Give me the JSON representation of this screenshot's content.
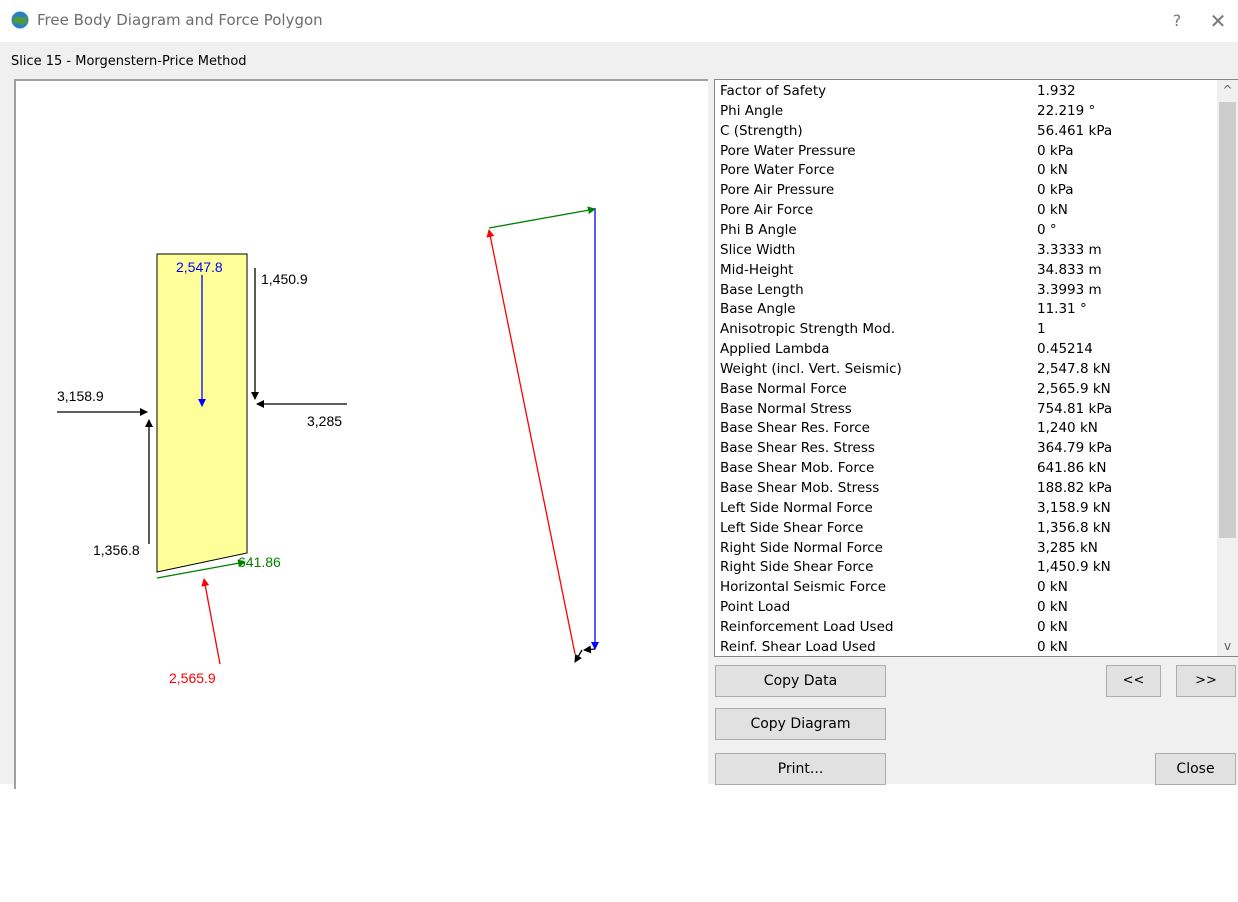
{
  "window": {
    "title": "Free Body Diagram and Force Polygon",
    "help_glyph": "?",
    "close_glyph": "✕",
    "icon": "earth-globe-icon"
  },
  "slice_label": "Slice  15 - Morgenstern-Price  Method",
  "diagram": {
    "weight_label": "2,547.8",
    "right_shear_label": "1,450.9",
    "left_normal_label": "3,158.9",
    "right_normal_label": "3,285",
    "left_shear_label": "1,356.8",
    "base_shear_label": "641.86",
    "base_normal_label": "2,565.9",
    "colors": {
      "slice_fill": "#ffff99",
      "weight": "#0000ff",
      "base_shear": "#008000",
      "base_normal": "#ff0000",
      "side_forces": "#000000"
    }
  },
  "properties": [
    {
      "name": "Factor of Safety",
      "value": "1.932"
    },
    {
      "name": "Phi Angle",
      "value": "22.219 °"
    },
    {
      "name": "C (Strength)",
      "value": "56.461 kPa"
    },
    {
      "name": "Pore Water Pressure",
      "value": "0 kPa"
    },
    {
      "name": "Pore Water Force",
      "value": "0 kN"
    },
    {
      "name": "Pore Air Pressure",
      "value": "0 kPa"
    },
    {
      "name": "Pore Air Force",
      "value": "0 kN"
    },
    {
      "name": "Phi B Angle",
      "value": "0 °"
    },
    {
      "name": "Slice Width",
      "value": "3.3333 m"
    },
    {
      "name": "Mid-Height",
      "value": "34.833 m"
    },
    {
      "name": "Base Length",
      "value": "3.3993 m"
    },
    {
      "name": "Base Angle",
      "value": "11.31 °"
    },
    {
      "name": "Anisotropic Strength Mod.",
      "value": "1"
    },
    {
      "name": "Applied Lambda",
      "value": "0.45214"
    },
    {
      "name": "Weight (incl. Vert. Seismic)",
      "value": "2,547.8 kN"
    },
    {
      "name": "Base Normal Force",
      "value": "2,565.9 kN"
    },
    {
      "name": "Base Normal Stress",
      "value": "754.81 kPa"
    },
    {
      "name": "Base Shear Res. Force",
      "value": "1,240 kN"
    },
    {
      "name": "Base Shear Res. Stress",
      "value": "364.79 kPa"
    },
    {
      "name": "Base Shear Mob. Force",
      "value": "641.86 kN"
    },
    {
      "name": "Base Shear Mob. Stress",
      "value": "188.82 kPa"
    },
    {
      "name": "Left Side Normal Force",
      "value": "3,158.9 kN"
    },
    {
      "name": "Left Side Shear Force",
      "value": "1,356.8 kN"
    },
    {
      "name": "Right Side Normal Force",
      "value": "3,285 kN"
    },
    {
      "name": "Right Side Shear Force",
      "value": "1,450.9 kN"
    },
    {
      "name": "Horizontal Seismic Force",
      "value": "0 kN"
    },
    {
      "name": "Point Load",
      "value": "0 kN"
    },
    {
      "name": "Reinforcement Load Used",
      "value": "0 kN"
    },
    {
      "name": "Reinf. Shear Load Used",
      "value": "0 kN"
    }
  ],
  "scroll": {
    "up_glyph": "^",
    "down_glyph": "v"
  },
  "buttons": {
    "copy_data": "Copy Data",
    "copy_diagram": "Copy Diagram",
    "print": "Print...",
    "prev": "<<",
    "next": ">>",
    "close": "Close"
  }
}
